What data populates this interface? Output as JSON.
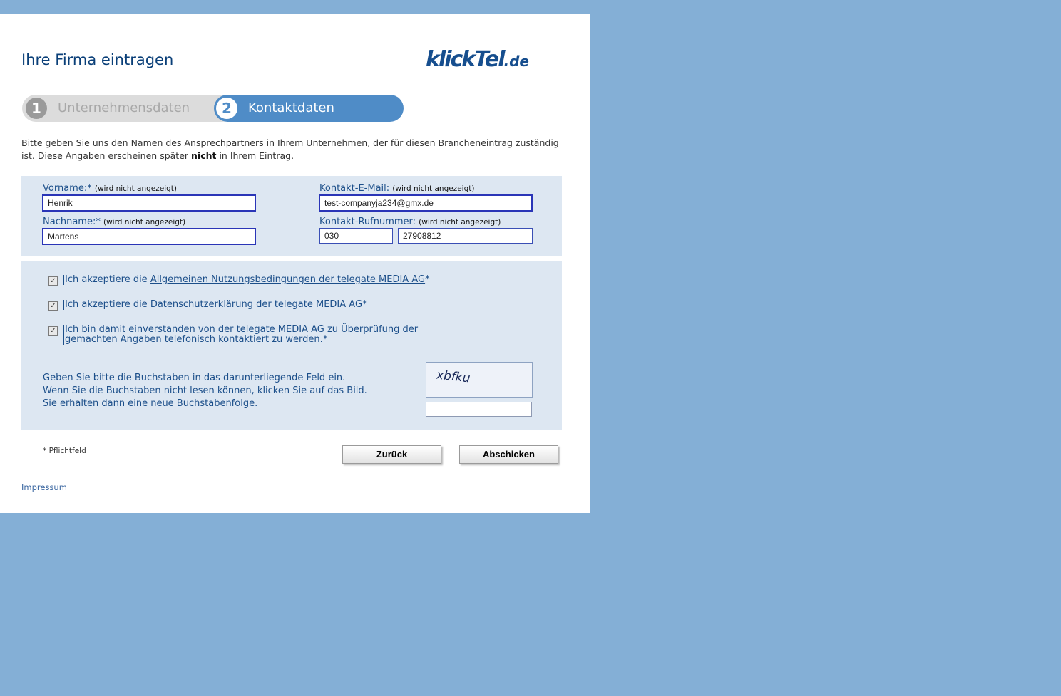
{
  "header": {
    "title": "Ihre Firma eintragen",
    "logo_main": "klickTel",
    "logo_tld": ".de"
  },
  "steps": [
    {
      "number": "1",
      "label": "Unternehmensdaten",
      "active": false
    },
    {
      "number": "2",
      "label": "Kontaktdaten",
      "active": true
    }
  ],
  "intro": {
    "line_part1": "Bitte geben Sie uns den Namen des Ansprechpartners in Ihrem Unternehmen, der für diesen Brancheneintrag zuständig ist. Diese Angaben erscheinen später ",
    "bold": "nicht",
    "line_part2": " in Ihrem Eintrag."
  },
  "form": {
    "firstname_label": "Vorname:*",
    "firstname_hint": "(wird nicht angezeigt)",
    "firstname_value": "Henrik",
    "lastname_label": "Nachname:*",
    "lastname_hint": "(wird nicht angezeigt)",
    "lastname_value": "Martens",
    "email_label": "Kontakt-E-Mail:",
    "email_hint": "(wird nicht angezeigt)",
    "email_value": "test-companyja234@gmx.de",
    "phone_label": "Kontakt-Rufnummer:",
    "phone_hint": "(wird nicht angezeigt)",
    "phone_prefix": "030",
    "phone_number": "27908812"
  },
  "consents": [
    {
      "prefix": "Ich akzeptiere die ",
      "link": "Allgemeinen Nutzungsbedingungen der telegate MEDIA AG",
      "suffix": "*",
      "checked": true
    },
    {
      "prefix": "Ich akzeptiere die ",
      "link": "Datenschutzerklärung der telegate MEDIA AG",
      "suffix": "*",
      "checked": true
    },
    {
      "text_line1": "Ich bin damit einverstanden von der telegate MEDIA AG zu Überprüfung der",
      "text_line2": "gemachten Angaben telefonisch kontaktiert zu werden.*",
      "checked": true
    }
  ],
  "captcha": {
    "line1": "Geben Sie bitte die Buchstaben in das darunterliegende Feld ein.",
    "line2": "Wenn Sie die Buchstaben nicht lesen können, klicken Sie auf das Bild.",
    "line3": "Sie erhalten dann eine neue Buchstabenfolge.",
    "image_text": "xbfku",
    "input_value": ""
  },
  "footer": {
    "required_note": "* Pflichtfeld",
    "back_label": "Zurück",
    "submit_label": "Abschicken",
    "impressum": "Impressum"
  },
  "colors": {
    "background": "#84afd6",
    "accent": "#4f8cc7",
    "form_bg": "#dde7f2",
    "text_blue": "#1c4f8a"
  }
}
